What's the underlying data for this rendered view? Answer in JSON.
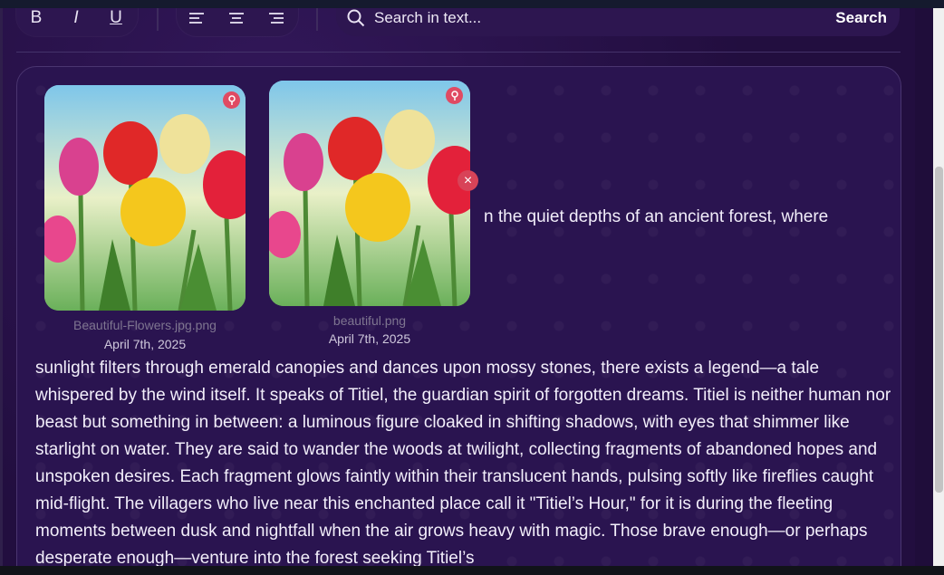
{
  "toolbar": {
    "bold_label": "B",
    "italic_label": "I",
    "underline_label": "U"
  },
  "search": {
    "placeholder": "Search in text...",
    "button_label": "Search"
  },
  "attachments": [
    {
      "filename": "Beautiful-Flowers.jpg.png",
      "date": "April 7th, 2025"
    },
    {
      "filename": "beautiful.png",
      "date": "April 7th, 2025"
    }
  ],
  "document": {
    "first_line": "n the quiet depths of an ancient forest, where",
    "body": "sunlight filters through emerald canopies and dances upon mossy stones, there exists a legend—a tale whispered by the wind itself. It speaks of Titiel, the guardian spirit of forgotten dreams. Titiel is neither human nor beast but something in between: a luminous figure cloaked in shifting shadows, with eyes that shimmer like starlight on water. They are said to wander the woods at twilight, collecting fragments of abandoned hopes and unspoken desires. Each fragment glows faintly within their translucent hands, pulsing softly like fireflies caught mid-flight. The villagers who live near this enchanted place call it \"Titiel’s Hour,\" for it is during the fleeting moments between dusk and nightfall when the air grows heavy with magic. Those brave enough—or perhaps desperate enough—venture into the forest seeking Titiel’s"
  },
  "colors": {
    "background": "#220e3f",
    "panel": "#2a1450",
    "accent_pin": "#e04a63"
  }
}
